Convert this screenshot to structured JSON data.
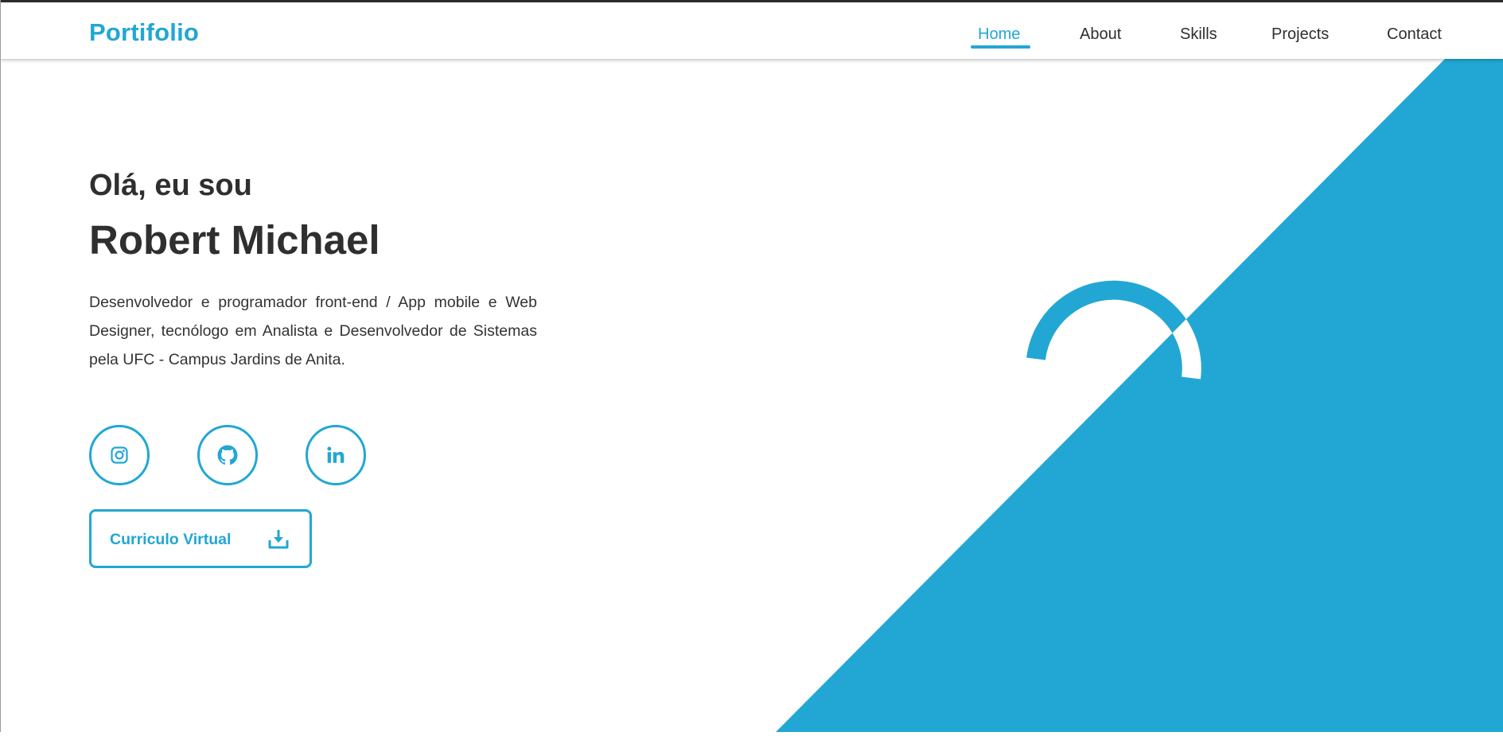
{
  "brand": {
    "logo_text": "Portifolio",
    "accent_color": "#22a7d4",
    "text_color": "#2f2f2f"
  },
  "nav": {
    "items": [
      {
        "label": "Home",
        "active": true
      },
      {
        "label": "About",
        "active": false
      },
      {
        "label": "Skills",
        "active": false
      },
      {
        "label": "Projects",
        "active": false
      },
      {
        "label": "Contact",
        "active": false
      }
    ]
  },
  "hero": {
    "greeting": "Olá, eu sou",
    "name": "Robert Michael",
    "description": "Desenvolvedor e programador front-end / App mobile e Web Designer, tecnólogo em Analista e Desenvolvedor de Sistemas pela UFC - Campus Jardins de Anita."
  },
  "socials": [
    {
      "icon": "instagram-icon"
    },
    {
      "icon": "github-icon"
    },
    {
      "icon": "linkedin-icon"
    }
  ],
  "cv_button": {
    "label": "Curriculo Virtual",
    "icon": "download-icon"
  }
}
